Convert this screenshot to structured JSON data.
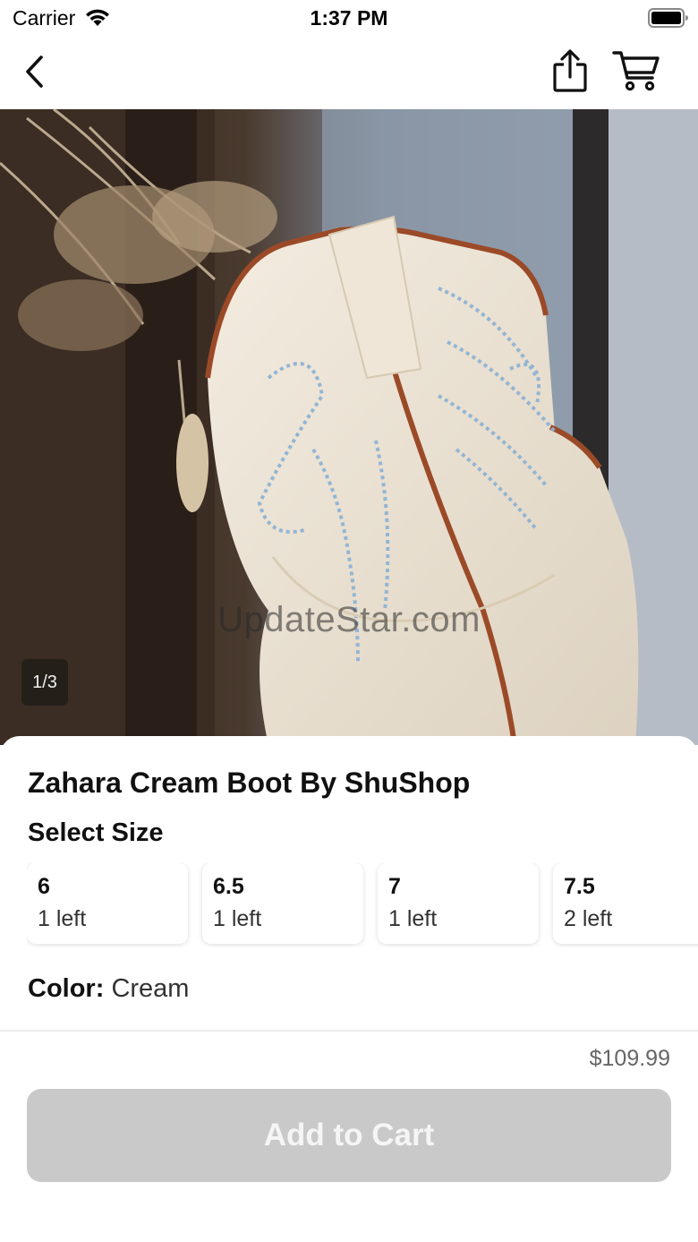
{
  "status_bar": {
    "carrier": "Carrier",
    "time": "1:37 PM"
  },
  "nav": {
    "back_icon": "chevron-left-icon",
    "share_icon": "share-icon",
    "cart_icon": "cart-icon"
  },
  "hero": {
    "watermark": "UpdateStar.com",
    "page_indicator": "1/3"
  },
  "product": {
    "title": "Zahara Cream Boot By ShuShop",
    "size_heading": "Select Size",
    "sizes": [
      {
        "size": "6",
        "stock": "1 left"
      },
      {
        "size": "6.5",
        "stock": "1 left"
      },
      {
        "size": "7",
        "stock": "1 left"
      },
      {
        "size": "7.5",
        "stock": "2 left"
      }
    ],
    "color_label": "Color:",
    "color_value": "Cream"
  },
  "checkout": {
    "price": "$109.99",
    "add_to_cart_label": "Add to Cart",
    "button_color": "#c9c9c9"
  }
}
